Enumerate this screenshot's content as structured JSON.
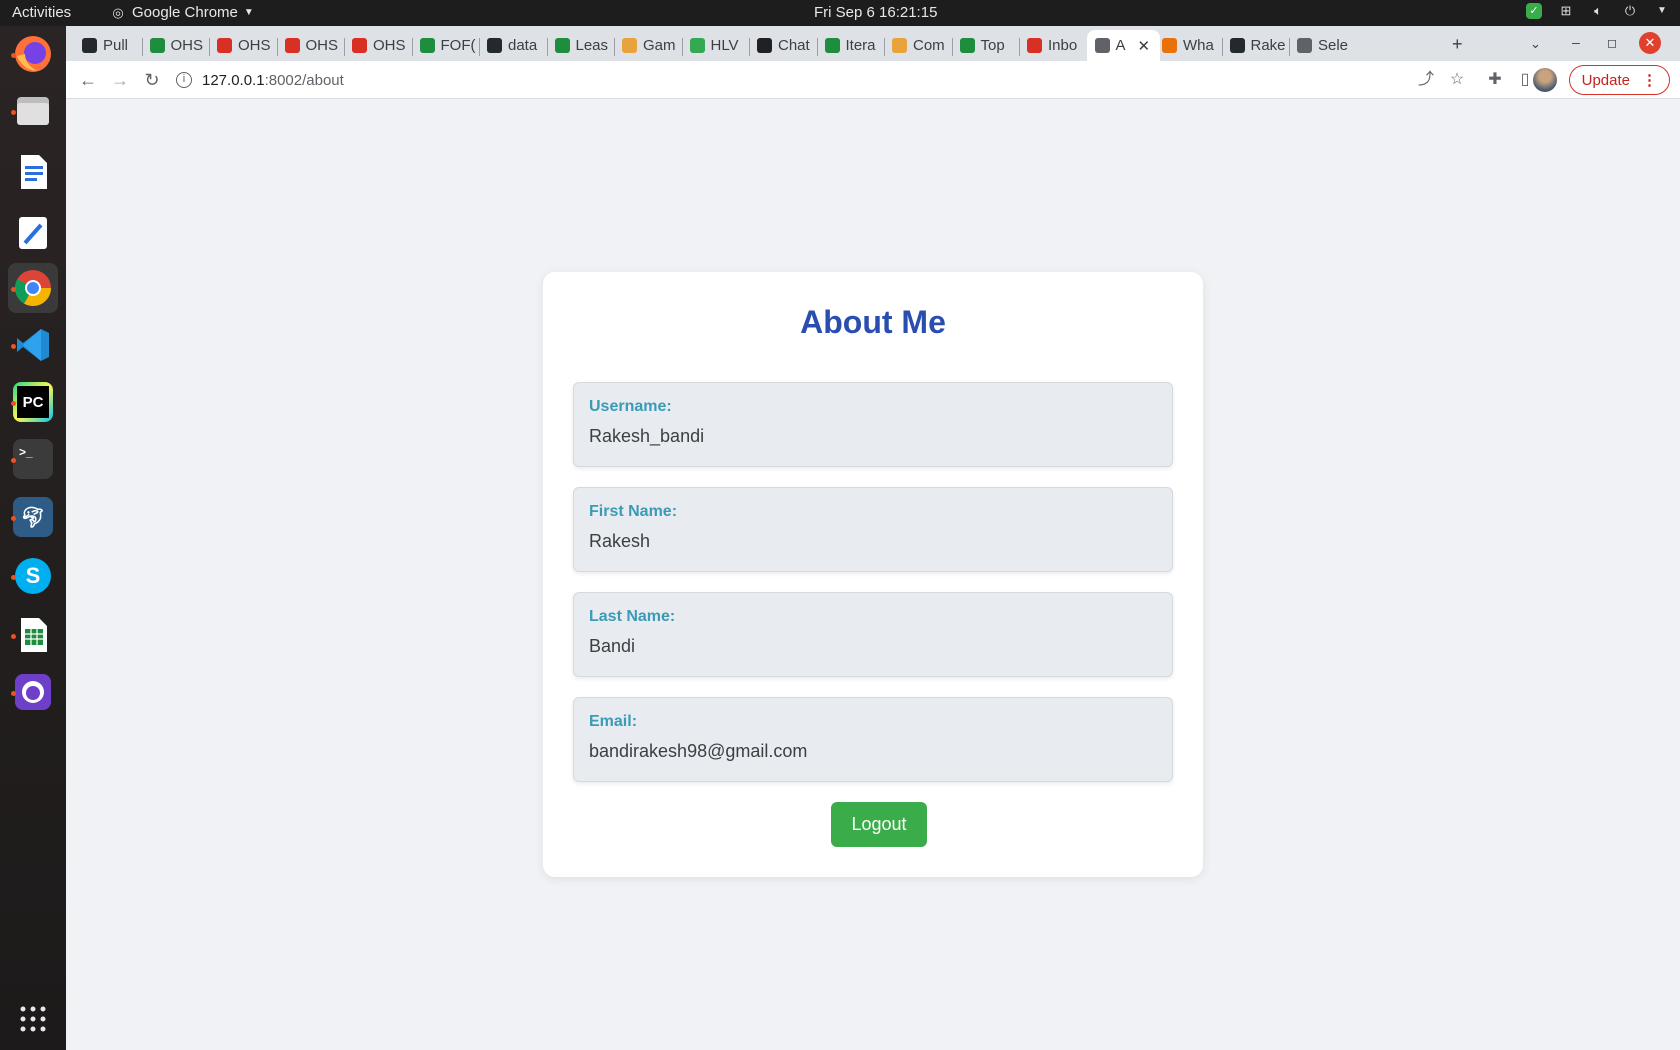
{
  "topbar": {
    "activities": "Activities",
    "app_menu": "Google Chrome",
    "clock": "Fri Sep 6  16:21:15"
  },
  "tabs": [
    {
      "label": "Pull",
      "favicon": "github-icon",
      "color": "#24292e"
    },
    {
      "label": "OHS",
      "favicon": "sheets-icon",
      "color": "#1e8e3e"
    },
    {
      "label": "OHS",
      "favicon": "red-cross-icon",
      "color": "#d93025"
    },
    {
      "label": "OHS",
      "favicon": "red-cross-icon",
      "color": "#d93025"
    },
    {
      "label": "OHS",
      "favicon": "red-cross-icon",
      "color": "#d93025"
    },
    {
      "label": "FOF(",
      "favicon": "sheets-icon",
      "color": "#1e8e3e"
    },
    {
      "label": "data",
      "favicon": "github-icon",
      "color": "#24292e"
    },
    {
      "label": "Leas",
      "favicon": "sheets-icon",
      "color": "#1e8e3e"
    },
    {
      "label": "Gam",
      "favicon": "ethereum-icon",
      "color": "#e8a33d"
    },
    {
      "label": "HLV",
      "favicon": "bar-chart-icon",
      "color": "#34a853"
    },
    {
      "label": "Chat",
      "favicon": "chatgpt-icon",
      "color": "#202124"
    },
    {
      "label": "Itera",
      "favicon": "infinity-icon",
      "color": "#1e8e3e"
    },
    {
      "label": "Com",
      "favicon": "ethereum-icon",
      "color": "#e8a33d"
    },
    {
      "label": "Top",
      "favicon": "infinity-icon",
      "color": "#1e8e3e"
    },
    {
      "label": "Inbo",
      "favicon": "gmail-icon",
      "color": "#d93025"
    },
    {
      "label": "A",
      "favicon": "globe-icon",
      "color": "#5f6368",
      "active": true
    },
    {
      "label": "Wha",
      "favicon": "record-icon",
      "color": "#e8710a"
    },
    {
      "label": "Rake",
      "favicon": "github-icon",
      "color": "#24292e"
    },
    {
      "label": "Sele",
      "favicon": "globe-icon",
      "color": "#5f6368"
    }
  ],
  "toolbar": {
    "url_host": "127.0.0.1",
    "url_path": ":8002/about",
    "update_label": "Update"
  },
  "card": {
    "title": "About Me",
    "fields": [
      {
        "label": "Username:",
        "value": "Rakesh_bandi"
      },
      {
        "label": "First Name:",
        "value": "Rakesh"
      },
      {
        "label": "Last Name:",
        "value": "Bandi"
      },
      {
        "label": "Email:",
        "value": "bandirakesh98@gmail.com"
      }
    ],
    "logout_label": "Logout"
  },
  "colors": {
    "title": "#2a4db0",
    "field_label": "#3a9bb6",
    "logout_bg": "#3aac4a",
    "update_border": "#d93025"
  },
  "dock": [
    "firefox-icon",
    "files-icon",
    "writer-icon",
    "text-editor-icon",
    "chrome-icon",
    "vscode-icon",
    "pycharm-icon",
    "terminal-icon",
    "mysql-workbench-icon",
    "skype-icon",
    "calc-icon",
    "github-desktop-icon",
    "app-grid-icon"
  ]
}
